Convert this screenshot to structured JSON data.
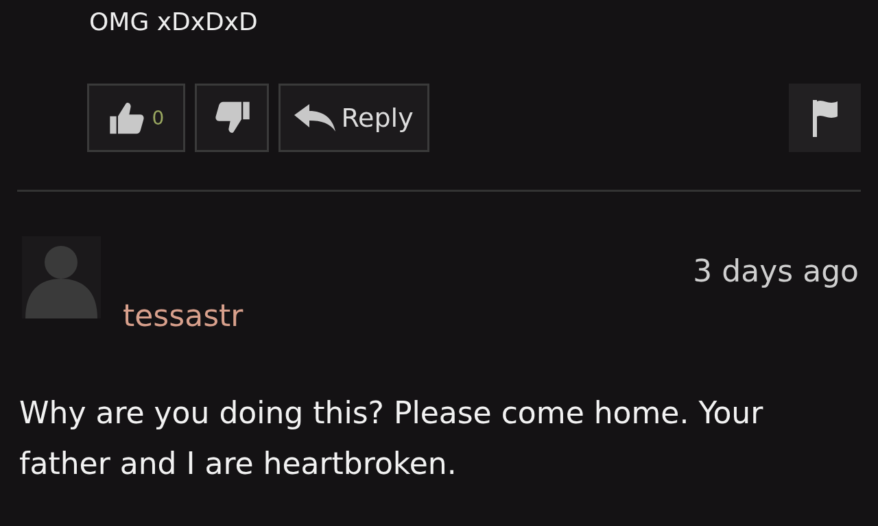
{
  "comments": [
    {
      "text": "OMG xDxDxD",
      "actions": {
        "likes": "0",
        "reply": "Reply"
      }
    },
    {
      "username": "tessastr",
      "time": "3 days ago",
      "text": "Why are you doing this? Please come home. Your father and I are heartbroken."
    }
  ]
}
